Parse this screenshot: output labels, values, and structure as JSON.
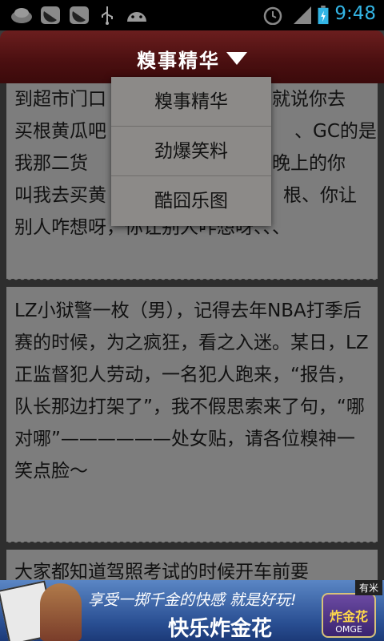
{
  "status_bar": {
    "time": "9:48",
    "icons": [
      "app-icon",
      "watermelon-icon",
      "watermelon-icon",
      "usb-icon",
      "android-icon",
      "alarm-icon",
      "signal-icon",
      "battery-icon"
    ]
  },
  "header": {
    "title": "糗事精华"
  },
  "dropdown": {
    "items": [
      "糗事精华",
      "劲爆笑料",
      "酷囧乐图"
    ]
  },
  "posts": [
    {
      "visible_text": "我那二货……到超市门口……就说你去买根黄瓜吧……、GC的是我那二货妹……晚上的你叫我去买黄瓜……根、你让别人咋想呀，你让别人咋想呀、、、"
    },
    {
      "text": "LZ小狱警一枚（男），记得去年NBA打季后赛的时候，为之疯狂，看之入迷。某日，LZ正监督犯人劳动，一名犯人跑来，“报告，队长那边打架了”，我不假思索来了句，“哪对哪”——————处女贴，请各位糗神一笑点脸～"
    },
    {
      "text": "大家都知道驾照考试的时候开车前要"
    }
  ],
  "post1_lines": [
    "到超市门口",
    "就说你去",
    "买根黄瓜吧",
    "、GC的是",
    "我那二货",
    "晚上的你",
    "叫我去买黄",
    "根、你让",
    "别人咋想呀，你让别人咋想呀、、、"
  ],
  "ad": {
    "line1": "享受一掷千金的快感 就是好玩!",
    "line2": "快乐炸金花",
    "logo_text": "炸金花",
    "logo_sub": "OMGE",
    "badge": "有米"
  },
  "colors": {
    "header": "#4a0f10",
    "clock": "#33b5e5",
    "card": "#7d7d7d"
  }
}
